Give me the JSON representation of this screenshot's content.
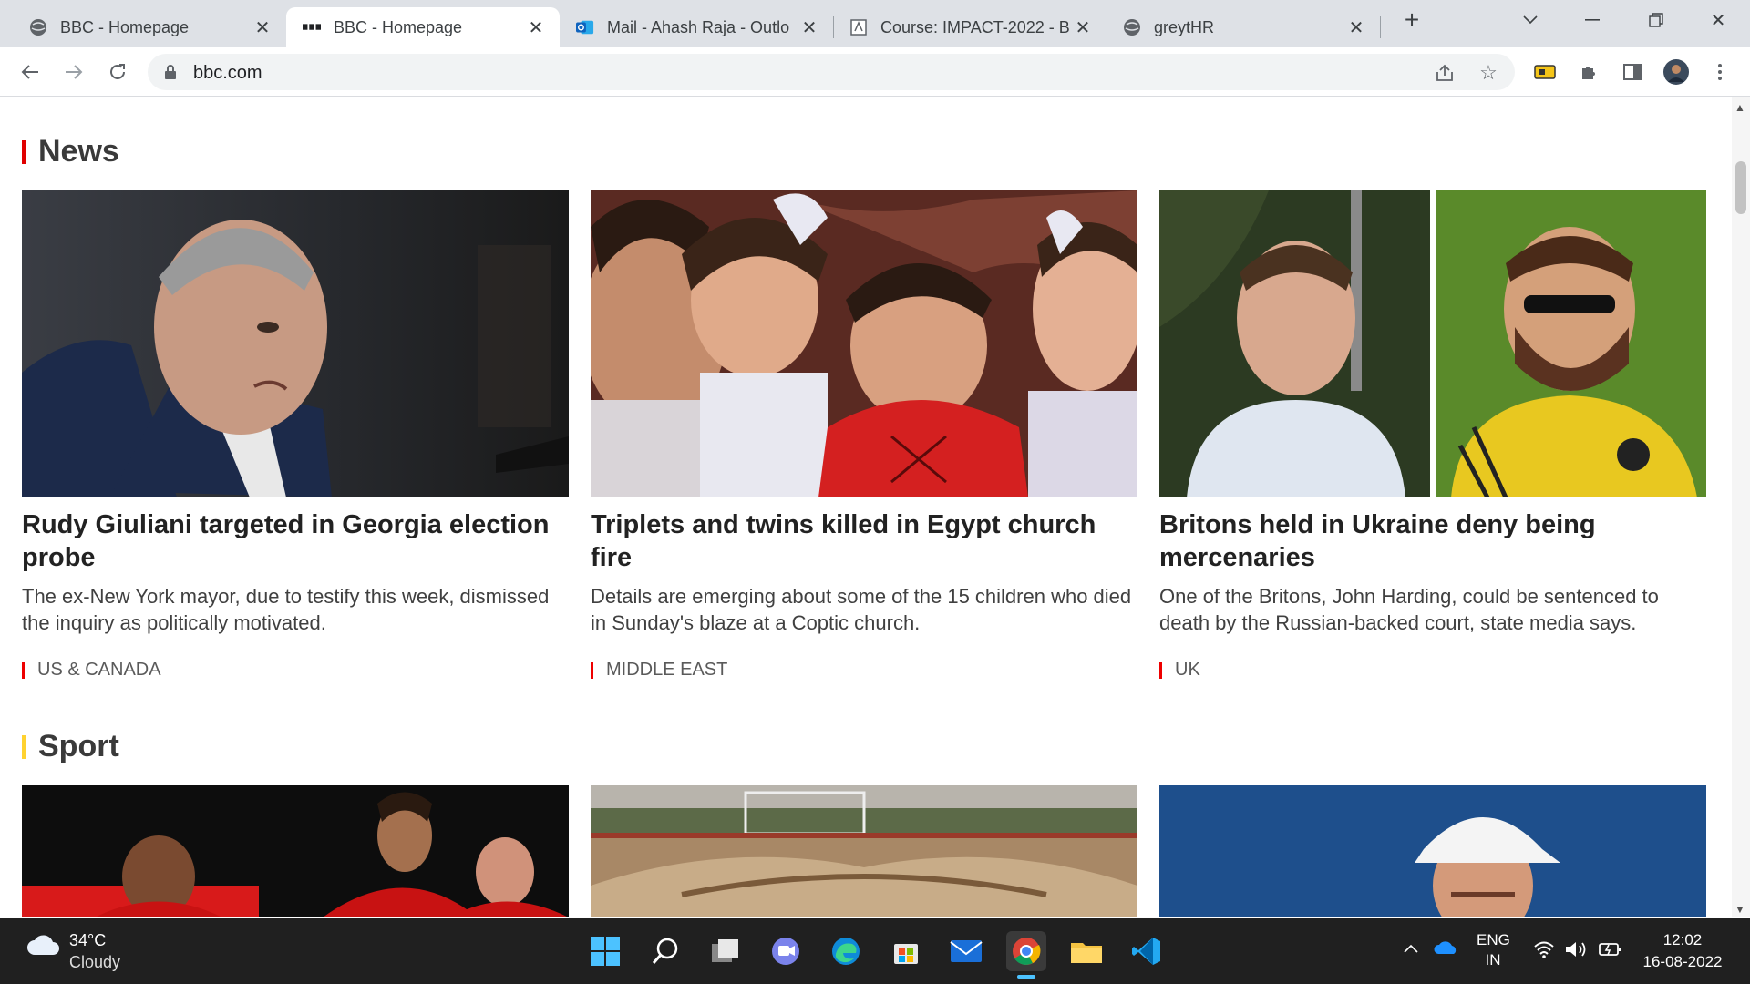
{
  "browser": {
    "tabs": [
      {
        "title": "BBC - Homepage",
        "icon": "globe-icon",
        "active": false
      },
      {
        "title": "BBC - Homepage",
        "icon": "bbc-icon",
        "active": true
      },
      {
        "title": "Mail - Ahash Raja - Outlo",
        "icon": "outlook-icon",
        "active": false
      },
      {
        "title": "Course: IMPACT-2022 - B",
        "icon": "course-icon",
        "active": false
      },
      {
        "title": "greytHR",
        "icon": "globe-icon",
        "active": false
      }
    ],
    "url": "bbc.com"
  },
  "news": {
    "heading": "News",
    "accent": "#e00000",
    "cards": [
      {
        "title": "Rudy Giuliani targeted in Georgia election probe",
        "summary": "The ex-New York mayor, due to testify this week, dismissed the inquiry as politically motivated.",
        "tag": "US & CANADA"
      },
      {
        "title": "Triplets and twins killed in Egypt church fire",
        "summary": "Details are emerging about some of the 15 children who died in Sunday's blaze at a Coptic church.",
        "tag": "MIDDLE EAST"
      },
      {
        "title": "Britons held in Ukraine deny being mercenaries",
        "summary": "One of the Britons, John Harding, could be sentenced to death by the Russian-backed court, state media says.",
        "tag": "UK"
      }
    ]
  },
  "sport": {
    "heading": "Sport",
    "accent": "#ffd230"
  },
  "taskbar": {
    "weather_temp": "34°C",
    "weather_desc": "Cloudy",
    "lang_line1": "ENG",
    "lang_line2": "IN",
    "time": "12:02",
    "date": "16-08-2022",
    "apps": [
      "windows-start-icon",
      "search-icon",
      "task-view-icon",
      "teams-icon",
      "edge-icon",
      "store-icon",
      "mail-icon",
      "chrome-icon",
      "file-explorer-icon",
      "vscode-icon"
    ]
  }
}
